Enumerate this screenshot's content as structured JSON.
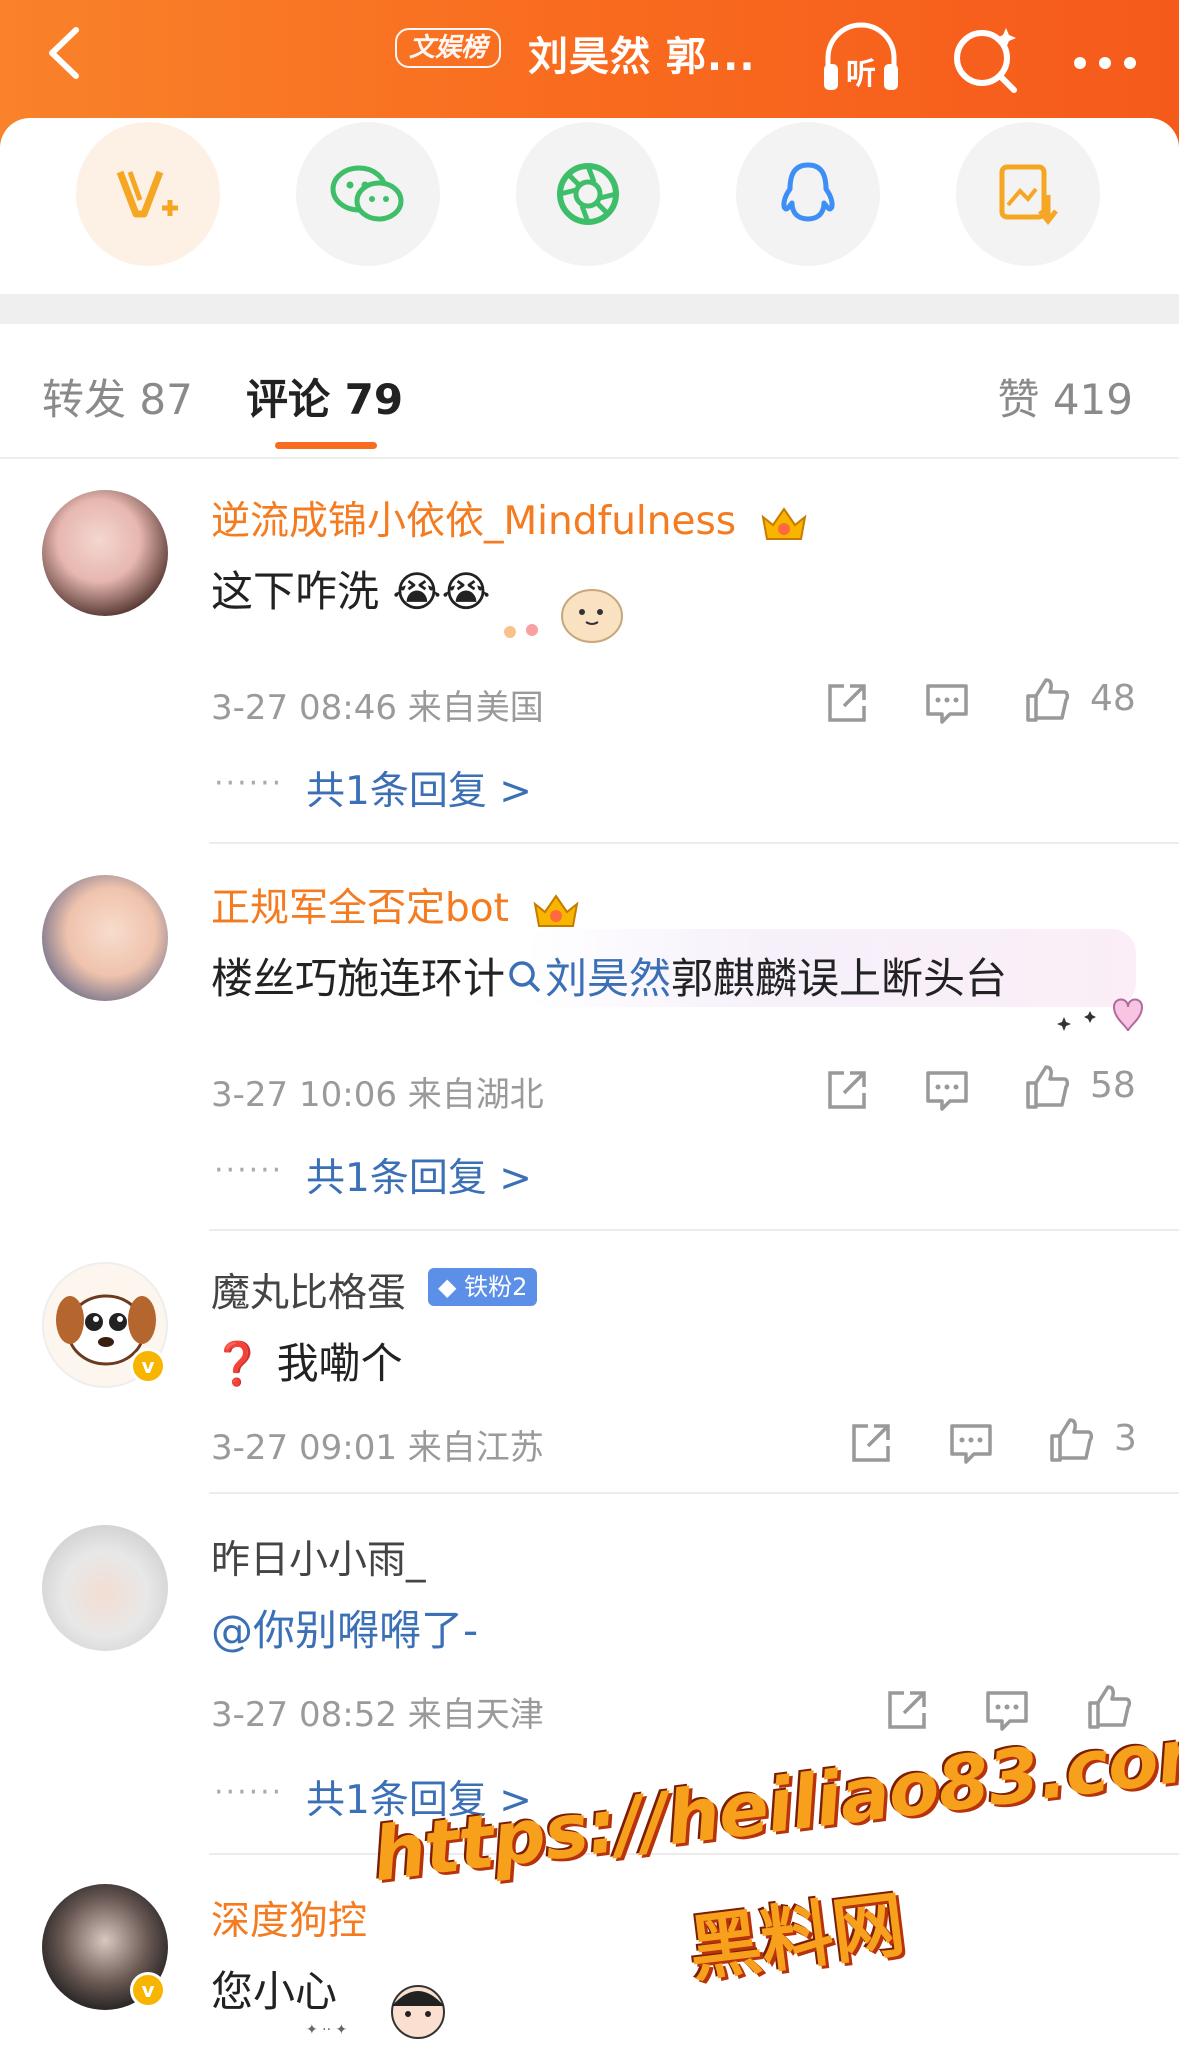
{
  "header": {
    "badge": "文娱榜",
    "title": "刘昊然 郭...",
    "listen_label": "听"
  },
  "share": {
    "items": [
      {
        "icon": "weibo-vplus-icon",
        "color": "#f5a623"
      },
      {
        "icon": "wechat-icon",
        "color": "#3fbe69"
      },
      {
        "icon": "wechat-moments-icon",
        "color": "#3fbe69"
      },
      {
        "icon": "qq-icon",
        "color": "#3d8ff5"
      },
      {
        "icon": "save-image-icon",
        "color": "#f5a623"
      }
    ]
  },
  "tabs": {
    "repost": "转发 87",
    "comments": "评论 79",
    "likes": "赞 419"
  },
  "comments": [
    {
      "name": "逆流成锦小依依_Mindfulness",
      "text": "这下咋洗",
      "emoji": "😭😭",
      "time": "3-27 08:46",
      "location": "来自美国",
      "likes": "48",
      "replies": "共1条回复 >"
    },
    {
      "name": "正规军全否定bot",
      "text_prefix": "楼丝巧施连环计",
      "topic_link": "刘昊然",
      "text_suffix": "郭麒麟误上断头台",
      "time": "3-27 10:06",
      "location": "来自湖北",
      "likes": "58",
      "replies": "共1条回复 >"
    },
    {
      "name": "魔丸比格蛋",
      "fan_badge": "铁粉2",
      "text_emoji": "❓",
      "text": "我嘞个",
      "time": "3-27 09:01",
      "location": "来自江苏",
      "likes": "3"
    },
    {
      "name": "昨日小小雨_",
      "mention": "@你别嘚嘚了-",
      "time": "3-27 08:52",
      "location": "来自天津",
      "likes": "",
      "replies": "共1条回复 >"
    },
    {
      "name": "深度狗控",
      "text": "您小心"
    }
  ],
  "watermark": {
    "url": "https://heiliao83.com",
    "label": "黑料网"
  },
  "colors": {
    "accent": "#f96b1f",
    "link": "#3b6fb6",
    "name_orange": "#f47b20"
  }
}
